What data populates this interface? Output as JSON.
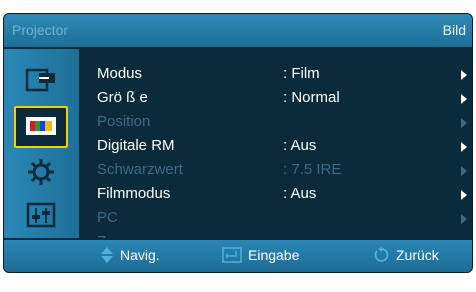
{
  "header": {
    "left_title": "Projector",
    "right_title": "Bild"
  },
  "sidebar": {
    "items": [
      {
        "icon": "input-icon"
      },
      {
        "icon": "picture-icon",
        "active": true
      },
      {
        "icon": "settings-gear-icon"
      },
      {
        "icon": "audio-adjust-icon"
      }
    ]
  },
  "menu": {
    "items": [
      {
        "label": "Modus",
        "value": ": Film",
        "enabled": true
      },
      {
        "label": "Grö ß e",
        "value": ": Normal",
        "enabled": true
      },
      {
        "label": "Position",
        "value": "",
        "enabled": false
      },
      {
        "label": "Digitale RM",
        "value": ": Aus",
        "enabled": true
      },
      {
        "label": "Schwarzwert",
        "value": ": 7.5 IRE",
        "enabled": false
      },
      {
        "label": "Filmmodus",
        "value": ": Aus",
        "enabled": true
      },
      {
        "label": "PC",
        "value": "",
        "enabled": false
      },
      {
        "label": "Zoom",
        "value": "",
        "enabled": false
      }
    ]
  },
  "footer": {
    "navig": "Navig.",
    "eingabe": "Eingabe",
    "zurueck": "Zurück"
  },
  "colors": {
    "panel": "#0b2a3c",
    "bar": "#2a86b4",
    "active_border": "#f5d000",
    "disabled_text": "#3d6b85"
  }
}
